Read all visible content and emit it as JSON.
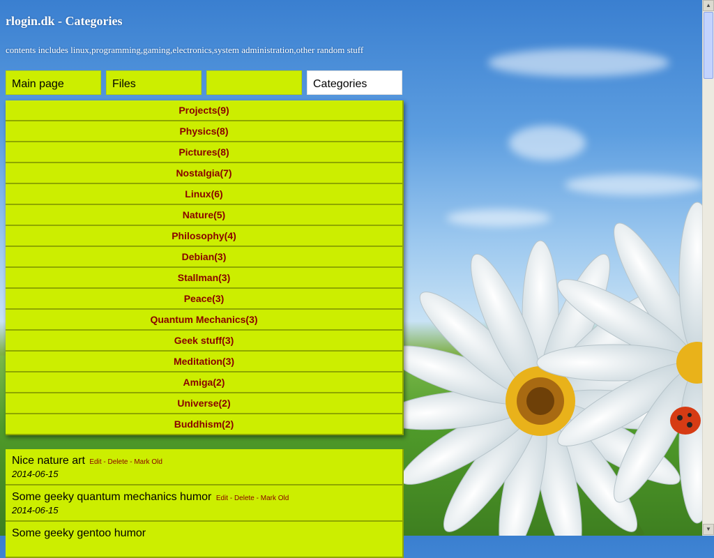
{
  "site": {
    "title": "rlogin.dk - Categories",
    "subtitle": "contents includes linux,programming,gaming,electronics,system administration,other random stuff"
  },
  "nav": {
    "tabs": [
      {
        "label": "Main page",
        "active": false
      },
      {
        "label": "Files",
        "active": false
      },
      {
        "label": "",
        "active": false
      },
      {
        "label": "Categories",
        "active": true
      }
    ]
  },
  "categories": [
    "Projects(9)",
    "Physics(8)",
    "Pictures(8)",
    "Nostalgia(7)",
    "Linux(6)",
    "Nature(5)",
    "Philosophy(4)",
    "Debian(3)",
    "Stallman(3)",
    "Peace(3)",
    "Quantum Mechanics(3)",
    "Geek stuff(3)",
    "Meditation(3)",
    "Amiga(2)",
    "Universe(2)",
    "Buddhism(2)"
  ],
  "posts": [
    {
      "title": "Nice nature art",
      "edit": "Edit",
      "delete": "Delete",
      "mark_old": "Mark Old",
      "date": "2014-06-15"
    },
    {
      "title": "Some geeky quantum mechanics humor",
      "edit": "Edit",
      "delete": "Delete",
      "mark_old": "Mark Old",
      "date": "2014-06-15"
    },
    {
      "title": "Some geeky gentoo humor",
      "edit": "",
      "delete": "",
      "mark_old": "",
      "date": ""
    }
  ],
  "colors": {
    "accent": "#ccee00",
    "link": "#880000",
    "active_tab": "#ffffff"
  }
}
